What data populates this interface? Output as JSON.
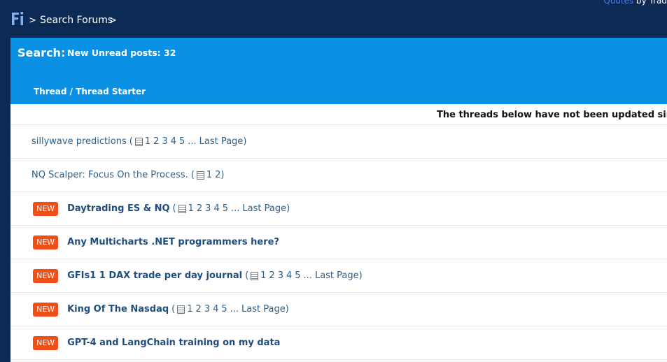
{
  "topbar": {
    "logo": "Fi",
    "breadcrumb_sep1": ">",
    "breadcrumb_link": "Search Forums",
    "breadcrumb_sep2": ">",
    "quotes_link": "Quotes",
    "quotes_suffix": " by Trad"
  },
  "header": {
    "title": "Search:",
    "subtitle": "New Unread posts: 32",
    "column_header": "Thread / Thread Starter"
  },
  "notice": "The threads below have not been updated since y",
  "threads": [
    {
      "title": "sillywave predictions",
      "is_new": false,
      "bold": false,
      "pages": [
        "1",
        "2",
        "3",
        "4",
        "5"
      ],
      "ellipsis": "...",
      "last_page": "Last Page"
    },
    {
      "title": "NQ Scalper: Focus On the Process.",
      "is_new": false,
      "bold": false,
      "pages": [
        "1",
        "2"
      ],
      "ellipsis": "",
      "last_page": ""
    },
    {
      "title": "Daytrading ES & NQ",
      "is_new": true,
      "bold": true,
      "pages": [
        "1",
        "2",
        "3",
        "4",
        "5"
      ],
      "ellipsis": "...",
      "last_page": "Last Page"
    },
    {
      "title": "Any Multicharts .NET programmers here?",
      "is_new": true,
      "bold": true,
      "pages": [],
      "ellipsis": "",
      "last_page": ""
    },
    {
      "title": "GFIs1 1 DAX trade per day journal",
      "is_new": true,
      "bold": true,
      "pages": [
        "1",
        "2",
        "3",
        "4",
        "5"
      ],
      "ellipsis": "...",
      "last_page": "Last Page"
    },
    {
      "title": "King Of The Nasdaq",
      "is_new": true,
      "bold": true,
      "pages": [
        "1",
        "2",
        "3",
        "4",
        "5"
      ],
      "ellipsis": "...",
      "last_page": "Last Page"
    },
    {
      "title": "GPT-4 and LangChain training on my data",
      "is_new": true,
      "bold": true,
      "pages": [],
      "ellipsis": "",
      "last_page": ""
    }
  ],
  "labels": {
    "new_badge": "NEW",
    "paren_open": "(",
    "paren_close": ")"
  },
  "colors": {
    "topbar": "#0d2a55",
    "header": "#0a91e6",
    "badge": "#f04f1a",
    "link": "#1e4d80",
    "logo": "#7fb4ef"
  }
}
